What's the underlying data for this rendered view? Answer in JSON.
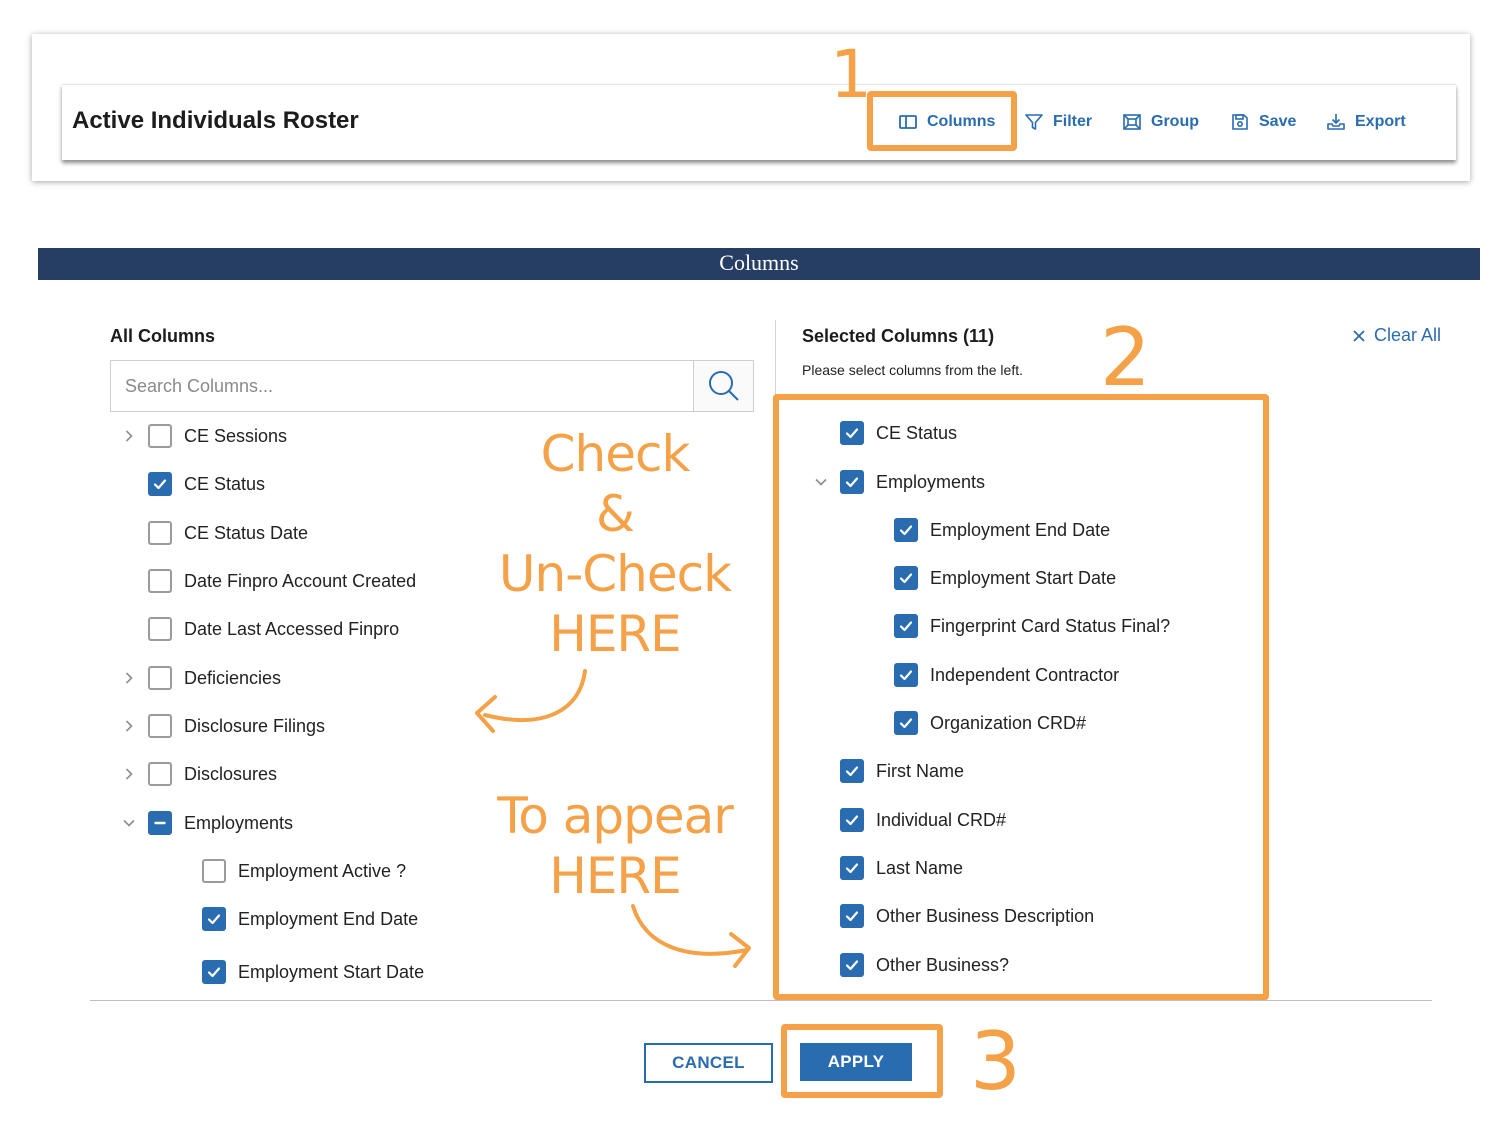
{
  "roster": {
    "title": "Active Individuals Roster",
    "toolbar": {
      "columns_label": "Columns",
      "filter_label": "Filter",
      "group_label": "Group",
      "save_label": "Save",
      "export_label": "Export"
    }
  },
  "dialog": {
    "title": "Columns",
    "all_columns": {
      "heading": "All Columns",
      "search_placeholder": "Search Columns...",
      "items": [
        {
          "label": "CE Sessions",
          "state": "unchecked",
          "expandable": true,
          "expanded": false
        },
        {
          "label": "CE Status",
          "state": "checked",
          "expandable": false
        },
        {
          "label": "CE Status Date",
          "state": "unchecked",
          "expandable": false
        },
        {
          "label": "Date Finpro Account Created",
          "state": "unchecked",
          "expandable": false
        },
        {
          "label": "Date Last Accessed Finpro",
          "state": "unchecked",
          "expandable": false
        },
        {
          "label": "Deficiencies",
          "state": "unchecked",
          "expandable": true,
          "expanded": false
        },
        {
          "label": "Disclosure Filings",
          "state": "unchecked",
          "expandable": true,
          "expanded": false
        },
        {
          "label": "Disclosures",
          "state": "unchecked",
          "expandable": true,
          "expanded": false
        },
        {
          "label": "Employments",
          "state": "partial",
          "expandable": true,
          "expanded": true
        },
        {
          "label": "Employment Active ?",
          "state": "unchecked",
          "child": true
        },
        {
          "label": "Employment End Date",
          "state": "checked",
          "child": true
        },
        {
          "label": "Employment Start Date",
          "state": "checked",
          "child": true
        }
      ]
    },
    "selected_columns": {
      "heading": "Selected Columns (11)",
      "hint": "Please select columns from the left.",
      "clear_all_label": "Clear All",
      "items": [
        {
          "label": "CE Status",
          "state": "checked"
        },
        {
          "label": "Employments",
          "state": "checked",
          "expandable": true,
          "expanded": true
        },
        {
          "label": "Employment End Date",
          "state": "checked",
          "child": true
        },
        {
          "label": "Employment Start Date",
          "state": "checked",
          "child": true
        },
        {
          "label": "Fingerprint Card Status Final?",
          "state": "checked",
          "child": true
        },
        {
          "label": "Independent Contractor",
          "state": "checked",
          "child": true
        },
        {
          "label": "Organization CRD#",
          "state": "checked",
          "child": true
        },
        {
          "label": "First Name",
          "state": "checked"
        },
        {
          "label": "Individual CRD#",
          "state": "checked"
        },
        {
          "label": "Last Name",
          "state": "checked"
        },
        {
          "label": "Other Business Description",
          "state": "checked"
        },
        {
          "label": "Other Business?",
          "state": "checked"
        }
      ]
    },
    "cancel_label": "CANCEL",
    "apply_label": "APPLY"
  },
  "annotations": {
    "step1": "1",
    "step2": "2",
    "step3": "3",
    "check_lines": [
      "Check",
      "&",
      "Un-Check",
      "HERE"
    ],
    "appear_lines": [
      "To appear",
      "HERE"
    ]
  },
  "colors": {
    "accent": "#2a6cb0",
    "header_bg": "#263e64",
    "annotation": "#f5a148"
  },
  "icons": {
    "columns": "columns-icon",
    "filter": "filter-icon",
    "group": "group-icon",
    "save": "save-icon",
    "export": "export-icon",
    "search": "search-icon",
    "clear": "close-icon"
  }
}
